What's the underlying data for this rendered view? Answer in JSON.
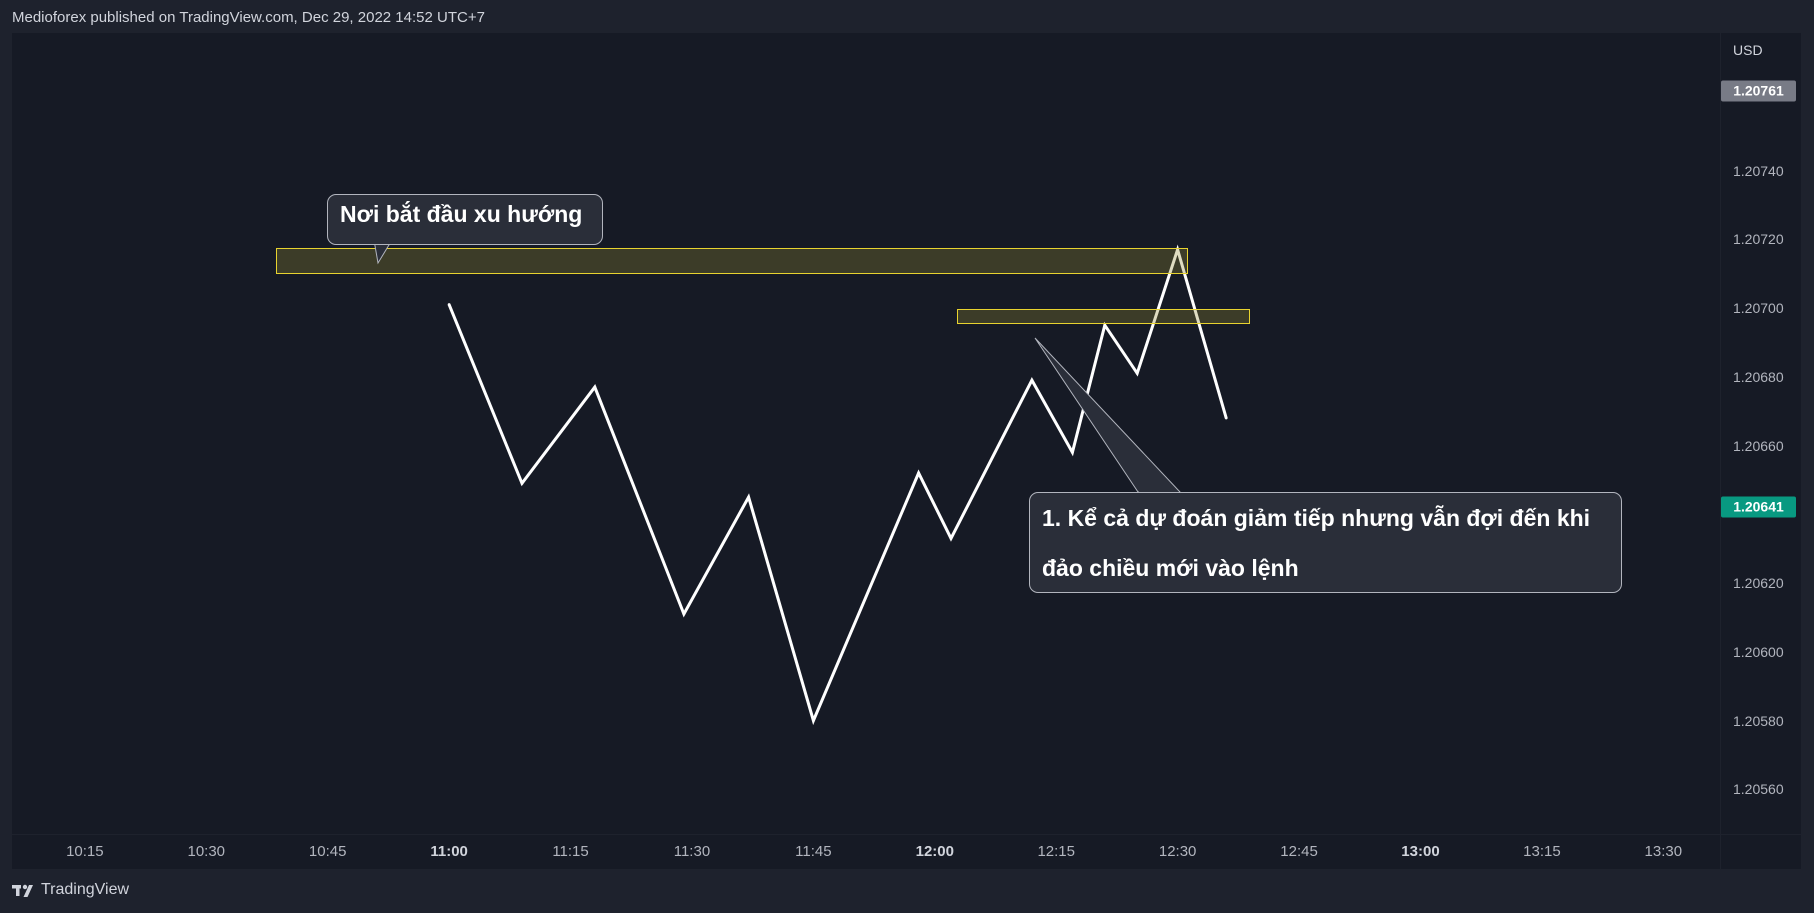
{
  "header": {
    "text": "Medioforex published on TradingView.com, Dec 29, 2022 14:52 UTC+7"
  },
  "price_scale": {
    "currency": "USD",
    "ticks": [
      "1.20740",
      "1.20720",
      "1.20700",
      "1.20680",
      "1.20660",
      "1.20620",
      "1.20600",
      "1.20580",
      "1.20560"
    ],
    "tags": [
      {
        "text": "1.20761",
        "color": "#787b86"
      },
      {
        "text": "1.20641",
        "color": "#089981"
      }
    ]
  },
  "time_scale": {
    "labels": [
      "10:15",
      "10:30",
      "10:45",
      "11:00",
      "11:15",
      "11:30",
      "11:45",
      "12:00",
      "12:15",
      "12:30",
      "12:45",
      "13:00",
      "13:15",
      "13:30"
    ],
    "bold": [
      "11:00",
      "12:00",
      "13:00"
    ]
  },
  "annotations": {
    "callout_1": "Nơi bắt đầu xu hướng",
    "callout_2_line1": "1. Kể cả dự đoán giảm tiếp nhưng vẫn đợi đến khi",
    "callout_2_line2": "đảo chiều mới vào lệnh"
  },
  "zones": [
    {
      "from_time": "10:45",
      "to_time": "12:55",
      "price_low": 1.20696,
      "price_high": 1.20704,
      "color": "#e8d32f"
    },
    {
      "from_time": "12:24",
      "to_time": "13:05",
      "price_low": 1.20679,
      "price_high": 1.20684,
      "color": "#e8d32f"
    }
  ],
  "footer": {
    "brand": "TradingView"
  },
  "chart_data": {
    "type": "line",
    "x": [
      "11:00",
      "11:09",
      "11:18",
      "11:29",
      "11:37",
      "11:45",
      "11:58",
      "12:02",
      "12:12",
      "12:17",
      "12:21",
      "12:25",
      "12:30",
      "12:36"
    ],
    "y": [
      1.20701,
      1.20649,
      1.20677,
      1.20611,
      1.20645,
      1.2058,
      1.20652,
      1.20633,
      1.20679,
      1.20658,
      1.20695,
      1.20681,
      1.20717,
      1.20668
    ],
    "ylim": [
      1.20547,
      1.2078
    ],
    "xlim": [
      "10:06",
      "13:37"
    ],
    "color": "#ffffff",
    "grid": false
  }
}
